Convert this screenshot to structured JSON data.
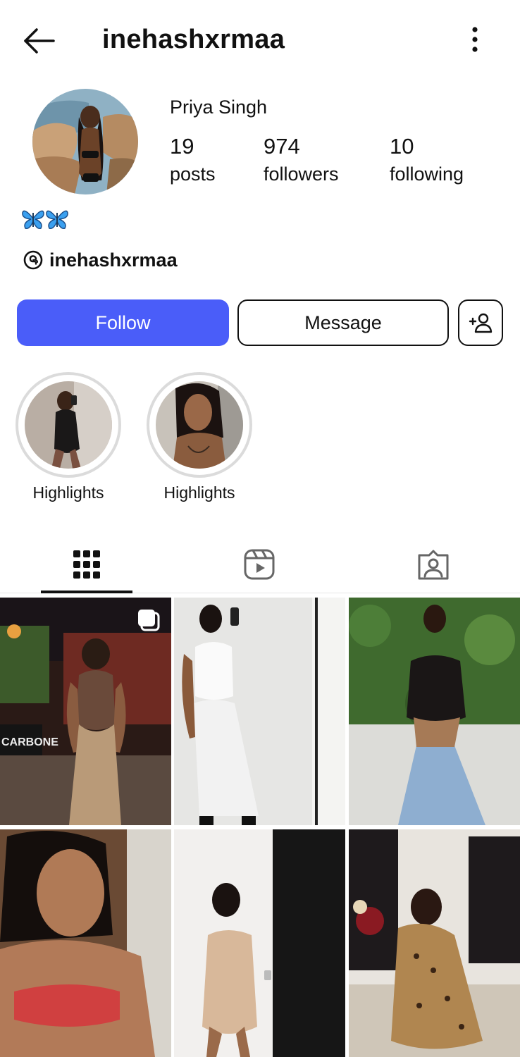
{
  "header": {
    "username": "inehashxrmaa"
  },
  "profile": {
    "display_name": "Priya Singh",
    "bio_emoji": "🦋🦋",
    "threads_handle": "inehashxrmaa"
  },
  "stats": [
    {
      "value": "19",
      "label": "posts"
    },
    {
      "value": "974",
      "label": "followers"
    },
    {
      "value": "10",
      "label": "following"
    }
  ],
  "actions": {
    "follow_label": "Follow",
    "message_label": "Message"
  },
  "highlights": [
    {
      "label": "Highlights"
    },
    {
      "label": "Highlights"
    }
  ],
  "tabs": [
    {
      "icon": "grid-icon",
      "active": true
    },
    {
      "icon": "reels-icon",
      "active": false
    },
    {
      "icon": "tagged-icon",
      "active": false
    }
  ],
  "posts": [
    {
      "sign_text": "CARBONE",
      "multi_photo": true
    },
    {
      "multi_photo": false
    },
    {
      "multi_photo": false
    },
    {
      "multi_photo": false
    },
    {
      "multi_photo": false
    },
    {
      "multi_photo": false
    }
  ],
  "colors": {
    "accent": "#4a5df9",
    "text": "#111111",
    "divider": "#e6e6e6"
  }
}
